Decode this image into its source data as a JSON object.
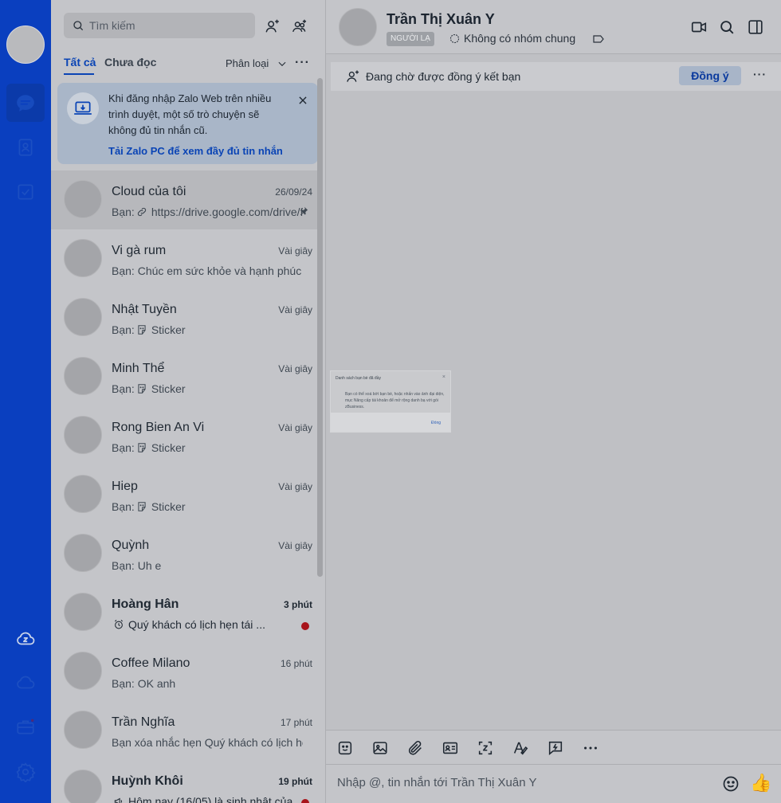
{
  "search": {
    "placeholder": "Tìm kiếm"
  },
  "filters": {
    "all": "Tất cả",
    "unread": "Chưa đọc",
    "classify": "Phân loại",
    "more": "···"
  },
  "banner": {
    "text": "Khi đăng nhập Zalo Web trên nhiều trình duyệt, một số trò chuyện sẽ không đủ tin nhắn cũ.",
    "link": "Tải Zalo PC để xem đầy đủ tin nhắn"
  },
  "conversations": [
    {
      "name": "Cloud của tôi",
      "time": "26/09/24",
      "prefix": "Bạn:",
      "preview": "https://drive.google.com/drive/folders",
      "icon": "link-icon",
      "pinned": true
    },
    {
      "name": "Vi gà rum",
      "time": "Vài giây",
      "prefix": "Bạn:",
      "preview": "Chúc em sức khỏe và hạnh phúc"
    },
    {
      "name": "Nhật Tuyền",
      "time": "Vài giây",
      "prefix": "Bạn:",
      "preview": "Sticker",
      "icon": "sticker-icon"
    },
    {
      "name": "Minh Thể",
      "time": "Vài giây",
      "prefix": "Bạn:",
      "preview": "Sticker",
      "icon": "sticker-icon"
    },
    {
      "name": "Rong Bien An Vi",
      "time": "Vài giây",
      "prefix": "Bạn:",
      "preview": "Sticker",
      "icon": "sticker-icon"
    },
    {
      "name": "Hiep",
      "time": "Vài giây",
      "prefix": "Bạn:",
      "preview": "Sticker",
      "icon": "sticker-icon"
    },
    {
      "name": "Quỳnh",
      "time": "Vài giây",
      "prefix": "Bạn:",
      "preview": "Uh e"
    },
    {
      "name": "Hoàng Hân",
      "time": "3 phút",
      "prefix": "",
      "preview": "Quý khách có lịch hẹn tái ...",
      "icon": "alarm-icon",
      "unread": true
    },
    {
      "name": "Coffee Milano",
      "time": "16 phút",
      "prefix": "Bạn:",
      "preview": "OK anh"
    },
    {
      "name": "Trần Nghĩa",
      "time": "17 phút",
      "prefix": "",
      "preview": "Bạn xóa nhắc hẹn Quý khách có lịch hẹn"
    },
    {
      "name": "Huỳnh Khôi",
      "time": "19 phút",
      "prefix": "",
      "preview": "Hôm nay (16/05) là sinh nhật của",
      "icon": "megaphone-icon",
      "unread": true
    }
  ],
  "chat": {
    "name": "Trần Thị Xuân Y",
    "stranger_badge": "NGƯỜI LẠ",
    "common_group": "Không có nhóm chung",
    "pending_text": "Đang chờ được đồng ý kết bạn",
    "accept_label": "Đồng ý",
    "more": "···"
  },
  "dialog": {
    "title": "Danh sách bạn bè đã đầy",
    "body": "Bạn có thể xoá bớt bạn bè, hoặc nhấn vào ảnh đại diện, mục Nâng cấp tài khoản để mở rộng danh bạ với gói zBusiness.",
    "button": "Đóng",
    "close": "×"
  },
  "composer": {
    "placeholder": "Nhập @, tin nhắn tới Trần Thị Xuân Y",
    "thumb": "👍"
  },
  "colors": {
    "rail": "#0a3fbf",
    "accent": "#0a44b5",
    "unread_dot": "#a8141b"
  }
}
